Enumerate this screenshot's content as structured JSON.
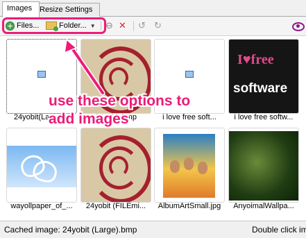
{
  "tabs": [
    {
      "label": "Images",
      "active": true
    },
    {
      "label": "Resize Settings",
      "active": false
    }
  ],
  "toolbar": {
    "files_label": "Files...",
    "folder_label": "Folder...",
    "icons": [
      "plus-icon",
      "folder-add-icon",
      "dropdown-caret-icon",
      "move-down-icon",
      "remove-icon",
      "rotate-left-icon",
      "rotate-right-icon",
      "preview-eye-icon"
    ]
  },
  "annotation": {
    "line1": "use these options to",
    "line2": "add images",
    "color": "#ec1c78"
  },
  "gallery": {
    "items": [
      {
        "caption": "24yobit(Large)...",
        "thumb": "placeholder",
        "selected": true
      },
      {
        "caption": "24yobit.bmp",
        "thumb": "debian-swirl"
      },
      {
        "caption": "i love free soft...",
        "thumb": "placeholder"
      },
      {
        "caption": "i love free softw...",
        "thumb": "ilovefree-logo",
        "logo_text_1": "I♥free",
        "logo_text_2": "software"
      },
      {
        "caption": "wayollpaper_of_...",
        "thumb": "sky-hearts"
      },
      {
        "caption": "24yobit (FILEmi...",
        "thumb": "debian-swirl"
      },
      {
        "caption": "AlbumArtSmall.jpg",
        "thumb": "movie-poster"
      },
      {
        "caption": "AnyoimalWallpa...",
        "thumb": "jungle"
      }
    ]
  },
  "status": {
    "left": "Cached image: 24yobit (Large).bmp",
    "right": "Double click im"
  }
}
